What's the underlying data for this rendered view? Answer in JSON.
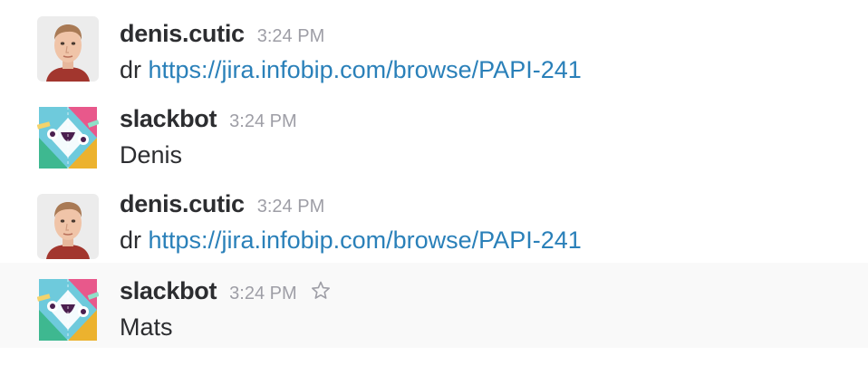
{
  "colors": {
    "text": "#2c2d30",
    "timestamp": "#9e9ea6",
    "link": "#2a80b9",
    "hover_row_bg": "#f9f9f9"
  },
  "messages": [
    {
      "author": "denis.cutic",
      "avatar_icon": "user-photo-avatar",
      "time": "3:24 PM",
      "text_prefix": "dr ",
      "link": "https://jira.infobip.com/browse/PAPI-241"
    },
    {
      "author": "slackbot",
      "avatar_icon": "slackbot-avatar",
      "time": "3:24 PM",
      "text": "Denis"
    },
    {
      "author": "denis.cutic",
      "avatar_icon": "user-photo-avatar",
      "time": "3:24 PM",
      "text_prefix": "dr ",
      "link": "https://jira.infobip.com/browse/PAPI-241"
    },
    {
      "author": "slackbot",
      "avatar_icon": "slackbot-avatar",
      "time": "3:24 PM",
      "text": "Mats",
      "star_icon": "star-outline-icon"
    }
  ]
}
